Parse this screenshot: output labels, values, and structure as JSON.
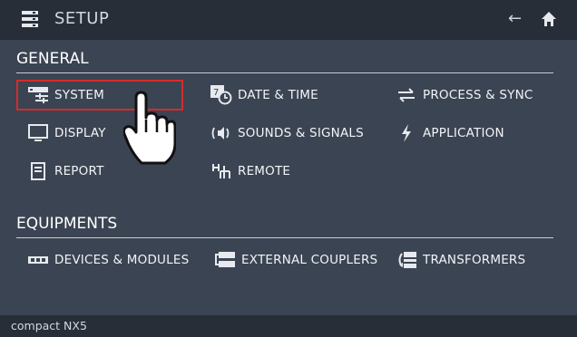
{
  "header": {
    "title": "SETUP",
    "back_icon": "arrow-left-icon",
    "home_icon": "home-icon",
    "menu_icon": "menu-icon"
  },
  "sections": {
    "general": "GENERAL",
    "equipments": "EQUIPMENTS"
  },
  "general_items": {
    "system": "SYSTEM",
    "date_time": "DATE & TIME",
    "process_sync": "PROCESS & SYNC",
    "display": "DISPLAY",
    "sounds_signals": "SOUNDS & SIGNALS",
    "application": "APPLICATION",
    "report": "REPORT",
    "remote": "REMOTE"
  },
  "equipment_items": {
    "devices_modules": "DEVICES & MODULES",
    "external_couplers": "EXTERNAL COUPLERS",
    "transformers": "TRANSFORMERS"
  },
  "selected_item": "SYSTEM",
  "footer": {
    "device": "compact NX5"
  },
  "colors": {
    "background": "#3b4452",
    "bar": "#272e38",
    "selection": "#d62b2b"
  }
}
